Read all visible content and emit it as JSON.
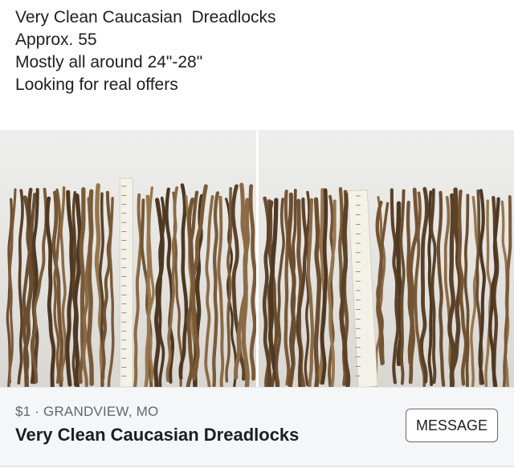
{
  "post": {
    "lines": [
      "Very Clean Caucasian  Dreadlocks",
      "Approx. 55",
      "Mostly all around 24\"-28\"",
      "",
      "Looking for real offers"
    ]
  },
  "photos": [
    {
      "name": "dreadlocks-photo-1"
    },
    {
      "name": "dreadlocks-photo-2"
    }
  ],
  "listing": {
    "price": "$1",
    "separator": " · ",
    "location": "GRANDVIEW, MO",
    "title": "Very Clean Caucasian Dreadlocks",
    "message_label": "MESSAGE"
  },
  "colors": {
    "text": "#1c1e21",
    "secondary_text": "#65676b",
    "listing_bg": "#f5f6f7",
    "hair_dark": "#5a4128",
    "hair_light": "#8b6a45"
  }
}
